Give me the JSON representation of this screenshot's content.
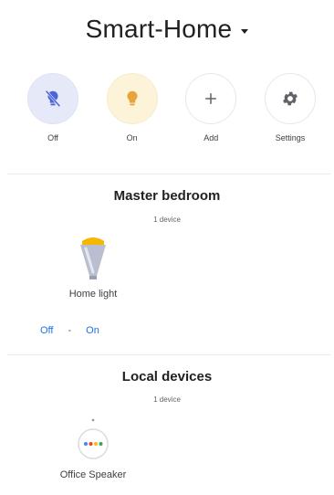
{
  "header": {
    "home_name": "Smart-Home"
  },
  "actions": [
    {
      "label": "Off",
      "icon": "light-off-icon"
    },
    {
      "label": "On",
      "icon": "light-on-icon"
    },
    {
      "label": "Add",
      "icon": "plus-icon"
    },
    {
      "label": "Settings",
      "icon": "gear-icon"
    }
  ],
  "rooms": [
    {
      "name": "Master bedroom",
      "count": "1 device",
      "devices": [
        {
          "name": "Home light",
          "icon": "light-bulb-icon",
          "off_label": "Off",
          "separator": "-",
          "on_label": "On"
        }
      ]
    }
  ],
  "local": {
    "title": "Local devices",
    "count": "1 device",
    "devices": [
      {
        "name": "Office Speaker",
        "icon": "speaker-icon"
      }
    ]
  },
  "colors": {
    "accent": "#1a73e8",
    "off_bg": "#e6e9f8",
    "on_bg": "#fcf3d8",
    "bulb_yellow": "#f6b700",
    "bulb_grey": "#b9bfd0"
  }
}
